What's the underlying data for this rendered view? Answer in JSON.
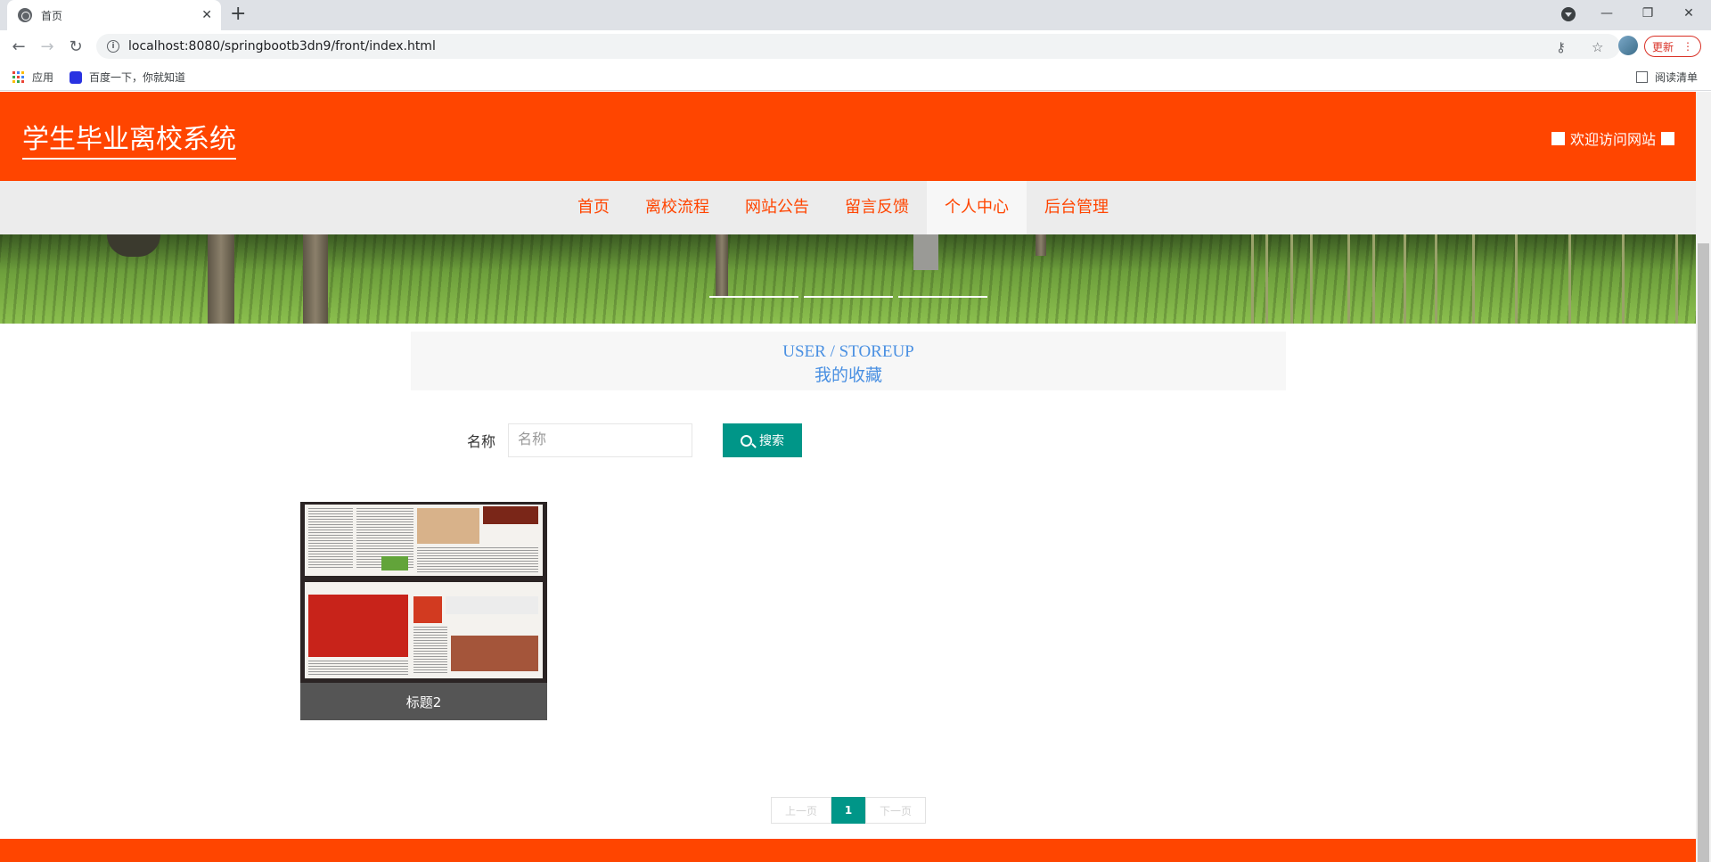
{
  "browser": {
    "tab_title": "首页",
    "url": "localhost:8080/springbootb3dn9/front/index.html",
    "update_label": "更新",
    "bookmarks": [
      {
        "label": "应用"
      },
      {
        "label": "百度一下，你就知道"
      }
    ],
    "reading_list_label": "阅读清单"
  },
  "header": {
    "site_title": "学生毕业离校系统",
    "welcome_text": "欢迎访问网站"
  },
  "nav": {
    "items": [
      {
        "label": "首页"
      },
      {
        "label": "离校流程"
      },
      {
        "label": "网站公告"
      },
      {
        "label": "留言反馈"
      },
      {
        "label": "个人中心",
        "active": true
      },
      {
        "label": "后台管理"
      }
    ]
  },
  "section": {
    "title_en": "USER / STOREUP",
    "title_zh": "我的收藏"
  },
  "search": {
    "label": "名称",
    "placeholder": "名称",
    "value": "",
    "button_label": "搜索"
  },
  "items": [
    {
      "caption": "标题2"
    }
  ],
  "pagination": {
    "prev_label": "上一页",
    "current_page": "1",
    "next_label": "下一页"
  },
  "colors": {
    "brand": "#ff4500",
    "accent": "#009688",
    "title_blue": "#4a90e2"
  }
}
